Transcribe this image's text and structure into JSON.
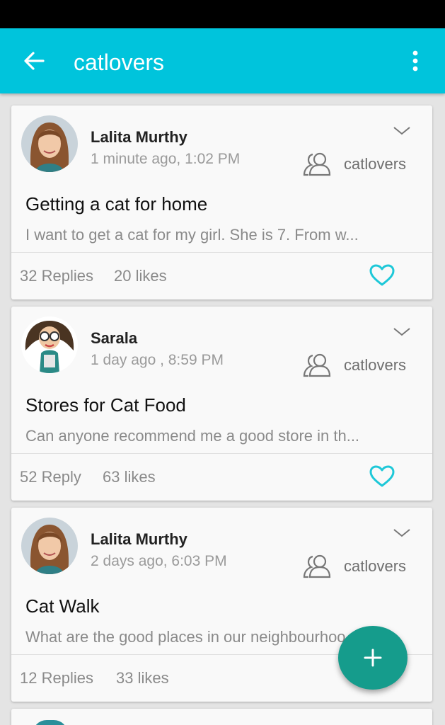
{
  "app_bar": {
    "title": "catlovers",
    "back_icon": "arrow-left-icon",
    "menu_icon": "more-vert-icon",
    "color": "#00c4dc"
  },
  "posts": [
    {
      "author": "Lalita Murthy",
      "time": "1 minute ago, 1:02 PM",
      "group": "catlovers",
      "title": "Getting a cat for home",
      "snippet": "I want to get a cat for my girl. She is 7. From w...",
      "replies": "32 Replies",
      "likes": "20 likes",
      "liked_icon": "heart-outline-icon"
    },
    {
      "author": "Sarala",
      "time": "1 day ago , 8:59 PM",
      "group": "catlovers",
      "title": "Stores for Cat Food",
      "snippet": "Can anyone recommend me a good store in th...",
      "replies": "52 Reply",
      "likes": "63 likes",
      "liked_icon": "heart-outline-icon"
    },
    {
      "author": "Lalita Murthy",
      "time": "2 days ago, 6:03 PM",
      "group": "catlovers",
      "title": "Cat Walk",
      "snippet": "What are the good places in our neighbourhoo...",
      "replies": "12 Replies",
      "likes": "33 likes"
    }
  ],
  "fab": {
    "icon": "plus-icon",
    "color": "#159c8c"
  },
  "accent_color": "#1ec8d8"
}
